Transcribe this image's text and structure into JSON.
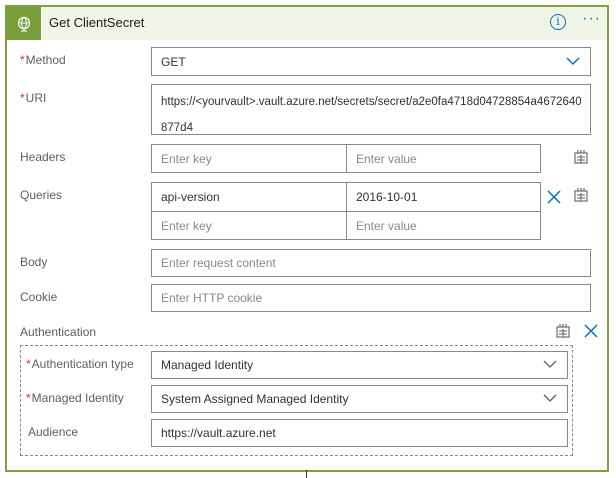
{
  "header": {
    "title": "Get ClientSecret",
    "icon": "globe-icon",
    "info_icon": "info-icon",
    "more_icon": "more-icon",
    "more_label": "···",
    "info_label": "i",
    "accent_color": "#7b9e3d"
  },
  "method": {
    "label": "Method",
    "required_mark": "*",
    "value": "GET"
  },
  "uri": {
    "label": "URI",
    "required_mark": "*",
    "value": "https://<yourvault>.vault.azure.net/secrets/secret/a2e0fa4718d04728854a4672640877d4"
  },
  "headers": {
    "label": "Headers",
    "key_placeholder": "Enter key",
    "value_placeholder": "Enter value"
  },
  "queries": {
    "label": "Queries",
    "rows": [
      {
        "key": "api-version",
        "value": "2016-10-01"
      }
    ],
    "key_placeholder": "Enter key",
    "value_placeholder": "Enter value"
  },
  "body": {
    "label": "Body",
    "placeholder": "Enter request content"
  },
  "cookie": {
    "label": "Cookie",
    "placeholder": "Enter HTTP cookie"
  },
  "authentication": {
    "label": "Authentication",
    "type_label": "Authentication type",
    "type_required_mark": "*",
    "type_value": "Managed Identity",
    "identity_label": "Managed Identity",
    "identity_required_mark": "*",
    "identity_value": "System Assigned Managed Identity",
    "audience_label": "Audience",
    "audience_value": "https://vault.azure.net"
  },
  "colors": {
    "accent_link": "#0f6cbd",
    "required": "#d13438",
    "border": "#8a8886"
  }
}
